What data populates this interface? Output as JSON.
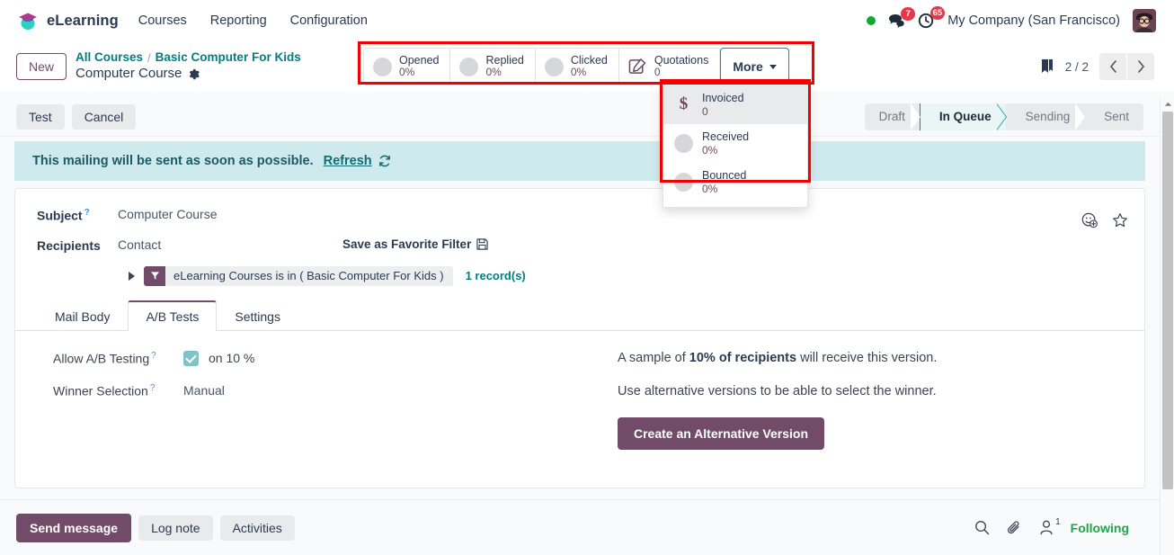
{
  "navbar": {
    "brand": "eLearning",
    "brand_logo_icon": "graduation-cap-icon",
    "menu": [
      "Courses",
      "Reporting",
      "Configuration"
    ],
    "presence_icon": "online-status-dot",
    "messages_icon": "chat-bubble-icon",
    "messages_count": "7",
    "activities_icon": "clock-icon",
    "activities_count": "65",
    "company": "My Company (San Francisco)",
    "avatar_icon": "user-avatar"
  },
  "control_panel": {
    "new_label": "New",
    "breadcrumb": {
      "root": "All Courses",
      "separator": "/",
      "parent": "Basic Computer For Kids",
      "title": "Computer Course",
      "settings_icon": "gear-icon"
    },
    "stats": [
      {
        "label": "Opened",
        "value": "0%",
        "icon": "progress-circle-icon"
      },
      {
        "label": "Replied",
        "value": "0%",
        "icon": "progress-circle-icon"
      },
      {
        "label": "Clicked",
        "value": "0%",
        "icon": "progress-circle-icon"
      },
      {
        "label": "Quotations",
        "value": "0",
        "icon": "quotation-pencil-icon"
      }
    ],
    "more_label": "More",
    "more_caret_icon": "caret-down-icon",
    "more_menu": [
      {
        "label": "Invoiced",
        "value": "0",
        "icon": "dollar-icon",
        "active": true
      },
      {
        "label": "Received",
        "value": "0%",
        "icon": "progress-circle-icon",
        "active": false
      },
      {
        "label": "Bounced",
        "value": "0%",
        "icon": "progress-circle-icon",
        "active": false
      }
    ],
    "bookmark_icon": "bookmark-icon",
    "pager": "2 / 2",
    "prev_icon": "chevron-left-icon",
    "next_icon": "chevron-right-icon"
  },
  "action_bar": {
    "buttons": [
      "Test",
      "Cancel"
    ],
    "stages": [
      {
        "label": "Draft",
        "active": false
      },
      {
        "label": "In Queue",
        "active": true
      },
      {
        "label": "Sending",
        "active": false
      },
      {
        "label": "Sent",
        "active": false
      }
    ]
  },
  "alert": {
    "message": "This mailing will be sent as soon as possible.",
    "link": "Refresh",
    "refresh_icon": "refresh-icon"
  },
  "form": {
    "tools": [
      {
        "icon": "add-reaction-icon"
      },
      {
        "icon": "star-outline-icon"
      }
    ],
    "subject_label": "Subject",
    "subject_value": "Computer Course",
    "recipients_label": "Recipients",
    "recipients_kind": "Contact",
    "save_filter_label": "Save as Favorite Filter",
    "save_filter_icon": "floppy-disk-icon",
    "expand_icon": "caret-right-icon",
    "domain_filter_icon": "funnel-icon",
    "domain_filter_text": "eLearning Courses is in ( Basic Computer For Kids )",
    "record_count": "1 record(s)",
    "tabs": [
      {
        "label": "Mail Body",
        "active": false
      },
      {
        "label": "A/B Tests",
        "active": true
      },
      {
        "label": "Settings",
        "active": false
      }
    ],
    "ab_tests": {
      "allow_label": "Allow A/B Testing",
      "allow_checked": true,
      "allow_suffix": "on 10 %",
      "winner_label": "Winner Selection",
      "winner_value": "Manual",
      "info_line_1_pre": "A sample of ",
      "info_line_1_bold": "10% of recipients",
      "info_line_1_post": " will receive this version.",
      "info_line_2": "Use alternative versions to be able to select the winner.",
      "create_button": "Create an Alternative Version"
    }
  },
  "chatter": {
    "send_label": "Send message",
    "log_label": "Log note",
    "activities_label": "Activities",
    "search_icon": "search-icon",
    "attachment_icon": "paperclip-icon",
    "followers_icon": "person-icon",
    "followers_count": "1",
    "following_label": "Following"
  },
  "colors": {
    "brand_purple": "#714b67",
    "teal": "#017e84",
    "alert_bg": "#cfeaec",
    "annotation_red": "#f40000",
    "following_green": "#1aa84a",
    "badge_red": "#e6384a"
  }
}
